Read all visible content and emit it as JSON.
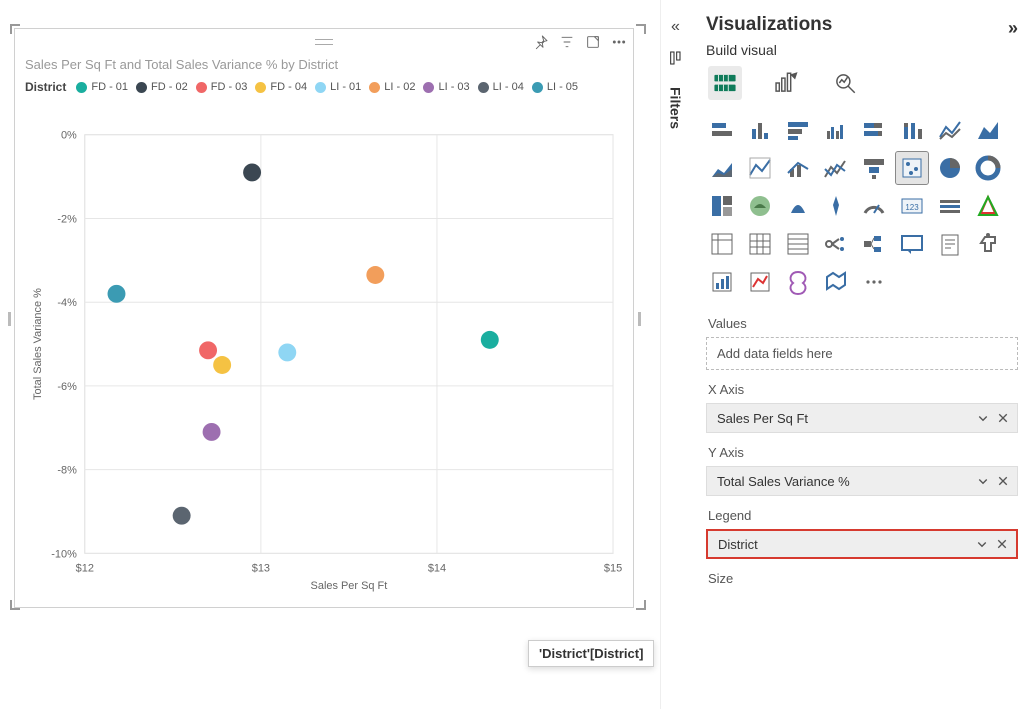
{
  "viz": {
    "title": "Sales Per Sq Ft and Total Sales Variance % by District",
    "legend_title": "District",
    "x_label": "Sales Per Sq Ft",
    "y_label": "Total Sales Variance %"
  },
  "legend_items": [
    {
      "label": "FD - 01",
      "color": "#1aae9f"
    },
    {
      "label": "FD - 02",
      "color": "#3b4752"
    },
    {
      "label": "FD - 03",
      "color": "#f06767"
    },
    {
      "label": "FD - 04",
      "color": "#f5c243"
    },
    {
      "label": "LI - 01",
      "color": "#8fd6f4"
    },
    {
      "label": "LI - 02",
      "color": "#f29e5b"
    },
    {
      "label": "LI - 03",
      "color": "#9d6fb0"
    },
    {
      "label": "LI - 04",
      "color": "#5b6570"
    },
    {
      "label": "LI - 05",
      "color": "#3b9bb3"
    }
  ],
  "x_ticks": [
    "$12",
    "$13",
    "$14",
    "$15"
  ],
  "y_ticks": [
    "0%",
    "-2%",
    "-4%",
    "-6%",
    "-8%",
    "-10%"
  ],
  "collapse": {
    "filters_label": "Filters"
  },
  "pane": {
    "title": "Visualizations",
    "subtitle": "Build visual",
    "values_label": "Values",
    "values_placeholder": "Add data fields here",
    "xaxis_label": "X Axis",
    "xaxis_field": "Sales Per Sq Ft",
    "yaxis_label": "Y Axis",
    "yaxis_field": "Total Sales Variance %",
    "legend_label": "Legend",
    "legend_field": "District",
    "size_label": "Size"
  },
  "tooltip": "'District'[District]",
  "chart_data": {
    "type": "scatter",
    "title": "Sales Per Sq Ft and Total Sales Variance % by District",
    "xlabel": "Sales Per Sq Ft",
    "ylabel": "Total Sales Variance %",
    "xlim": [
      12,
      15
    ],
    "ylim": [
      -10,
      0
    ],
    "series": [
      {
        "name": "FD - 01",
        "color": "#1aae9f",
        "x": 14.3,
        "y": -4.9
      },
      {
        "name": "FD - 02",
        "color": "#3b4752",
        "x": 12.95,
        "y": -0.9
      },
      {
        "name": "FD - 03",
        "color": "#f06767",
        "x": 12.7,
        "y": -5.15
      },
      {
        "name": "FD - 04",
        "color": "#f5c243",
        "x": 12.78,
        "y": -5.5
      },
      {
        "name": "LI - 01",
        "color": "#8fd6f4",
        "x": 13.15,
        "y": -5.2
      },
      {
        "name": "LI - 02",
        "color": "#f29e5b",
        "x": 13.65,
        "y": -3.35
      },
      {
        "name": "LI - 03",
        "color": "#9d6fb0",
        "x": 12.72,
        "y": -7.1
      },
      {
        "name": "LI - 04",
        "color": "#5b6570",
        "x": 12.55,
        "y": -9.1
      },
      {
        "name": "LI - 05",
        "color": "#3b9bb3",
        "x": 12.18,
        "y": -3.8
      }
    ]
  }
}
